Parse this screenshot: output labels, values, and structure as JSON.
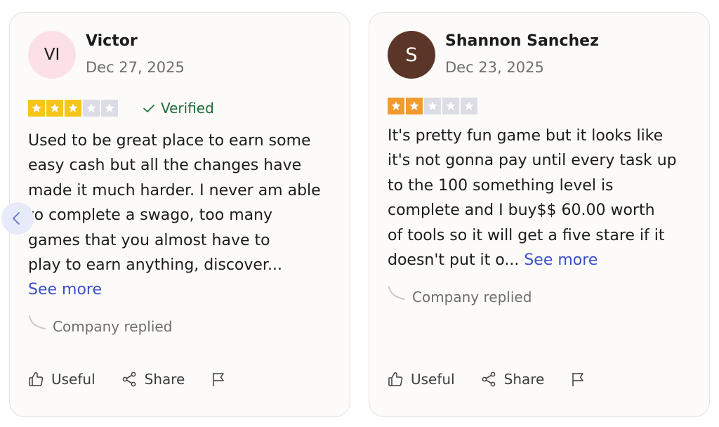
{
  "reviews": [
    {
      "avatar_initials": "VI",
      "avatar_color": "#fbe0e7",
      "name": "Victor",
      "date": "Dec 27, 2025",
      "rating": 3,
      "rating_max": 5,
      "star_color": "#f5c518",
      "verified_label": "Verified",
      "text_lines": [
        "Used to be great place to earn some",
        "easy cash but all the changes have",
        "made it much harder. I never am able",
        "to complete a swago, too many",
        "games that you almost have to",
        "play to earn anything, discover..."
      ],
      "see_more_label": "See more",
      "company_replied_label": "Company replied",
      "actions": {
        "useful_label": "Useful",
        "share_label": "Share"
      }
    },
    {
      "avatar_initials": "S",
      "avatar_color": "#5b3628",
      "name": "Shannon Sanchez",
      "date": "Dec 23, 2025",
      "rating": 2,
      "rating_max": 5,
      "star_color": "#f39a2d",
      "text_lines": [
        "It's pretty fun game but it looks like",
        "it's not gonna pay until every task up",
        "to the 100 something level is",
        "complete and I buy$$ 60.00 worth",
        "of tools so it will get a five stare if it",
        "doesn't put it o..."
      ],
      "see_more_label": "See more",
      "company_replied_label": "Company replied",
      "actions": {
        "useful_label": "Useful",
        "share_label": "Share"
      }
    }
  ],
  "icons": {
    "prev": "chevron-left-icon",
    "useful": "thumbs-up-icon",
    "share": "share-icon",
    "report": "flag-icon",
    "verified": "checkmark-icon",
    "reply": "reply-curve-icon"
  },
  "colors": {
    "empty_star": "#dcdce6",
    "link": "#3b50c8",
    "verified": "#1b6b35"
  }
}
